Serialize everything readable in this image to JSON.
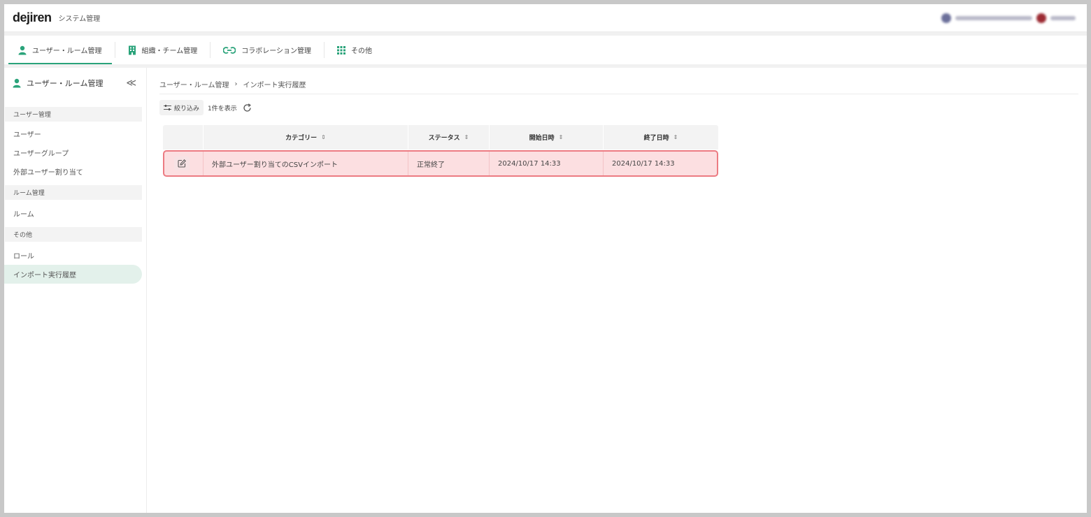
{
  "header": {
    "logo": "dejiren",
    "app_title": "システム管理"
  },
  "tabs": [
    {
      "label": "ユーザー・ルーム管理",
      "icon": "person-icon"
    },
    {
      "label": "組織・チーム管理",
      "icon": "building-icon"
    },
    {
      "label": "コラボレーション管理",
      "icon": "link-icon"
    },
    {
      "label": "その他",
      "icon": "grid-icon"
    }
  ],
  "sidebar": {
    "title": "ユーザー・ルーム管理",
    "collapse_glyph": "≪",
    "sections": [
      {
        "label": "ユーザー管理",
        "items": [
          "ユーザー",
          "ユーザーグループ",
          "外部ユーザー割り当て"
        ]
      },
      {
        "label": "ルーム管理",
        "items": [
          "ルーム"
        ]
      },
      {
        "label": "その他",
        "items": [
          "ロール",
          "インポート実行履歴"
        ]
      }
    ]
  },
  "breadcrumb": {
    "parent": "ユーザー・ルーム管理",
    "separator": "›",
    "current": "インポート実行履歴"
  },
  "toolbar": {
    "filter_label": "絞り込み",
    "count_label": "1件を表示"
  },
  "table": {
    "columns": [
      "カテゴリー",
      "ステータス",
      "開始日時",
      "終了日時"
    ],
    "sort_glyph": "⇕",
    "rows": [
      {
        "category": "外部ユーザー割り当てのCSVインポート",
        "status": "正常終了",
        "start": "2024/10/17 14:33",
        "end": "2024/10/17 14:33"
      }
    ]
  },
  "colors": {
    "accent": "#2aa37a",
    "highlight_fill": "#fcdfe1",
    "highlight_border": "#ec7b82"
  }
}
